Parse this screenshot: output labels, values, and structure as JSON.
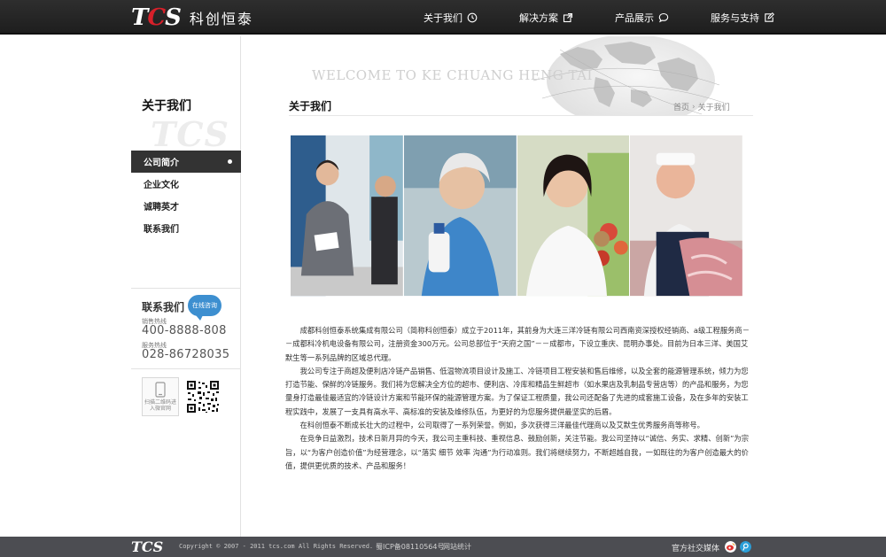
{
  "header": {
    "logo_mark_t": "T",
    "logo_mark_c": "C",
    "logo_mark_s": "S",
    "logo_text": "科创恒泰",
    "nav": [
      {
        "label": "关于我们",
        "icon": "clock-icon"
      },
      {
        "label": "解决方案",
        "icon": "external-link-icon"
      },
      {
        "label": "产品展示",
        "icon": "chat-bubble-icon"
      },
      {
        "label": "服务与支持",
        "icon": "edit-icon"
      }
    ]
  },
  "sidebar": {
    "title": "关于我们",
    "watermark": "TCS",
    "items": [
      {
        "label": "公司简介",
        "active": true
      },
      {
        "label": "企业文化",
        "active": false
      },
      {
        "label": "诚聘英才",
        "active": false
      },
      {
        "label": "联系我们",
        "active": false
      }
    ],
    "contact_title": "联系我们",
    "online_button": "在线咨询",
    "sales_label": "销售热线",
    "sales_number": "400-8888-808",
    "service_label": "服务热线",
    "service_number": "028-86728035",
    "qr_caption": "扫描二维码进入微官网"
  },
  "banner": {
    "text": "WELCOME TO KE CHUANG HENG TAI"
  },
  "main": {
    "page_title": "关于我们",
    "breadcrumb_home": "首页",
    "breadcrumb_current": "关于我们",
    "paragraphs": [
      "成都科创恒泰系统集成有限公司（简称科创恒泰）成立于2011年，其前身为大连三洋冷链有限公司西南资深授权经销商、a级工程服务商－－成都科冷机电设备有限公司，注册资金300万元。公司总部位于“天府之国”－－成都市，下设立重庆、昆明办事处。目前为日本三洋、美国艾默生等一系列品牌的区域总代理。",
      "我公司专注于商超及便利店冷链产品销售、低温物流项目设计及施工、冷链项目工程安装和售后维修，以及全套的能源管理系统，倾力为您打造节能、保鲜的冷链服务。我们将为您解决全方位的超市、便利店、冷库和精品生鲜超市（如水果店及乳制品专营店等）的产品和服务，为您量身打造最佳最适宜的冷链设计方案和节能环保的能源管理方案。为了保证工程质量，我公司还配备了先进的成套施工设备，及在多年的安装工程实践中，发展了一支具有高水平、高标准的安装及维修队伍，为更好的为您服务提供最坚实的后盾。",
      "在科创恒泰不断成长壮大的过程中，公司取得了一系列荣誉。例如，多次获得三洋最佳代理商以及艾默生优秀服务商等称号。",
      "在竞争日益激烈，技术日新月异的今天，我公司主重科技、重视信息、鼓励创新，关注节能。我公司坚持以“诚信、务实、求精、创新”为宗旨，以“为客户创造价值”为经营理念，以“落实 细节 效率 沟通”为行动准则。我们将继续努力，不断超越自我，一如既往的为客户创造最大的价值，提供更优质的技术、产品和服务！"
    ]
  },
  "footer": {
    "logo": "TCS",
    "copyright": "Copyright © 2007 - 2011 tcs.com All Rights Reserved.",
    "icp": "蜀ICP备08110564号",
    "stats": "网站统计",
    "social_label": "官方社交媒体"
  },
  "colors": {
    "header_bg": "#262626",
    "accent_red": "#d7202a",
    "active_menu_bg": "#333333",
    "online_blue": "#3d8fd0",
    "footer_bg": "#4c4d52"
  }
}
